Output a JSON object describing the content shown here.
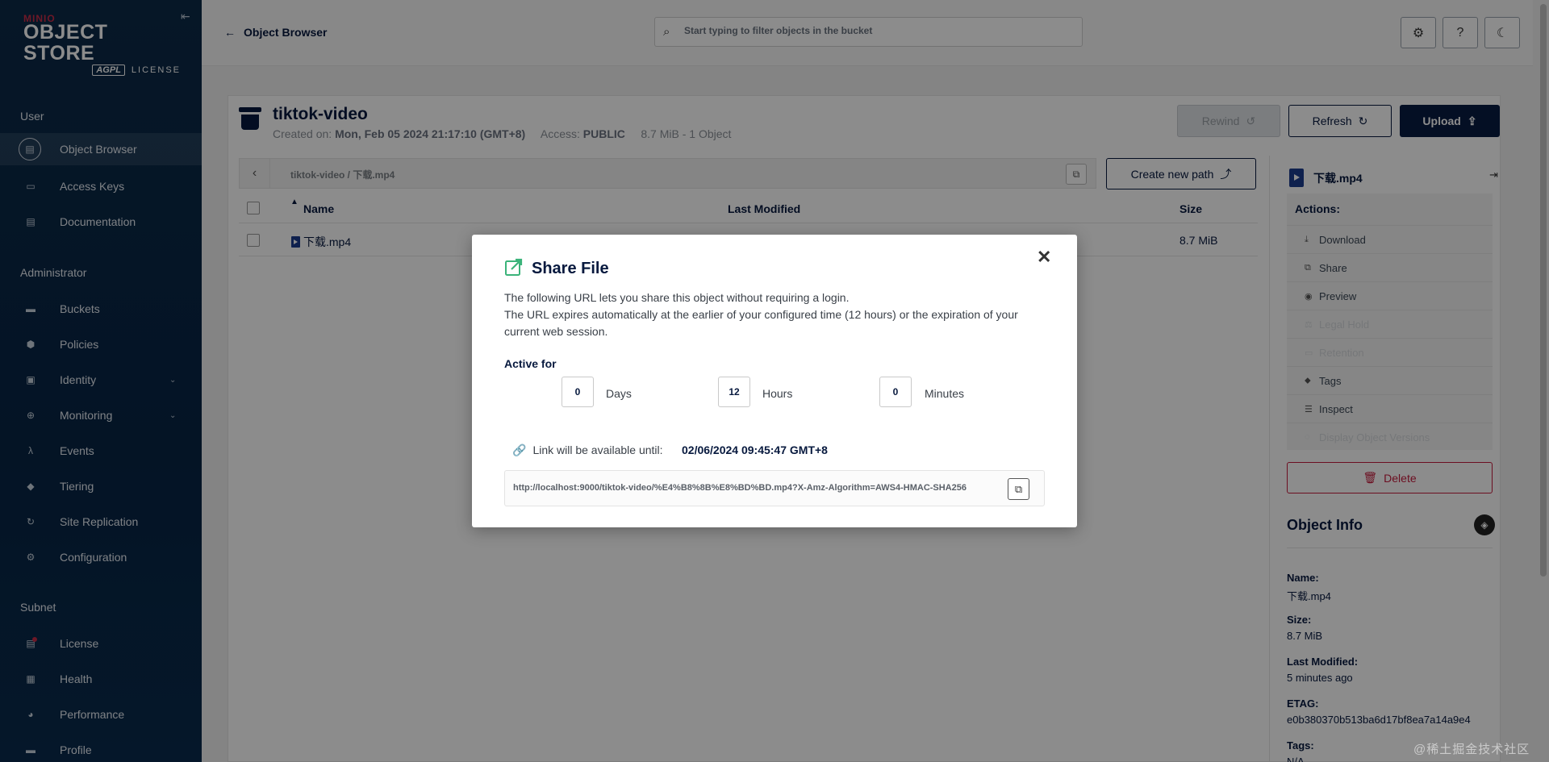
{
  "sidebar": {
    "logo": {
      "brand": "MINIO",
      "title": "OBJECT STORE",
      "badge": "AGPL",
      "license": "LICENSE"
    },
    "sections": {
      "user": "User",
      "administrator": "Administrator",
      "subnet": "Subnet"
    },
    "items": {
      "object_browser": "Object Browser",
      "access_keys": "Access Keys",
      "documentation": "Documentation",
      "buckets": "Buckets",
      "policies": "Policies",
      "identity": "Identity",
      "monitoring": "Monitoring",
      "events": "Events",
      "tiering": "Tiering",
      "site_replication": "Site Replication",
      "configuration": "Configuration",
      "license": "License",
      "health": "Health",
      "performance": "Performance",
      "profile": "Profile"
    }
  },
  "topbar": {
    "back_label": "Object Browser",
    "search_placeholder": "Start typing to filter objects in the bucket"
  },
  "bucket": {
    "name": "tiktok-video",
    "created_label": "Created on:",
    "created_value": "Mon, Feb 05 2024 21:17:10 (GMT+8)",
    "access_label": "Access:",
    "access_value": "PUBLIC",
    "summary": "8.7 MiB - 1 Object"
  },
  "buttons": {
    "rewind": "Rewind",
    "refresh": "Refresh",
    "upload": "Upload",
    "create_path": "Create new path",
    "delete": "Delete"
  },
  "path": {
    "crumbs": "tiktok-video  /  下载.mp4"
  },
  "table": {
    "headers": {
      "name": "Name",
      "modified": "Last Modified",
      "size": "Size"
    },
    "rows": [
      {
        "name": "下载.mp4",
        "size": "8.7 MiB"
      }
    ]
  },
  "details": {
    "file_name": "下载.mp4",
    "actions_title": "Actions:",
    "actions": [
      "Download",
      "Share",
      "Preview",
      "Legal Hold",
      "Retention",
      "Tags",
      "Inspect",
      "Display Object Versions"
    ],
    "info_title": "Object Info",
    "info": {
      "name_label": "Name:",
      "name_value": "下载.mp4",
      "size_label": "Size:",
      "size_value": "8.7 MiB",
      "modified_label": "Last Modified:",
      "modified_value": "5 minutes ago",
      "etag_label": "ETAG:",
      "etag_value": "e0b380370b513ba6d17bf8ea7a14a9e4",
      "tags_label": "Tags:",
      "tags_value": "N/A"
    }
  },
  "modal": {
    "title": "Share File",
    "desc1": "The following URL lets you share this object without requiring a login.",
    "desc2": "The URL expires automatically at the earlier of your configured time (12 hours) or the expiration of your current web session.",
    "active_for": "Active for",
    "days_value": "0",
    "days_label": "Days",
    "hours_value": "12",
    "hours_label": "Hours",
    "minutes_value": "0",
    "minutes_label": "Minutes",
    "until_label": "Link will be available until:",
    "until_value": "02/06/2024 09:45:47 GMT+8",
    "url": "http://localhost:9000/tiktok-video/%E4%B8%8B%E8%BD%BD.mp4?X-Amz-Algorithm=AWS4-HMAC-SHA256"
  },
  "watermark": "@稀土掘金技术社区",
  "colors": {
    "sidebar": "#0b2a48",
    "primary": "#081c42",
    "danger": "#c51b3c",
    "accent_green": "#3bb37a"
  }
}
